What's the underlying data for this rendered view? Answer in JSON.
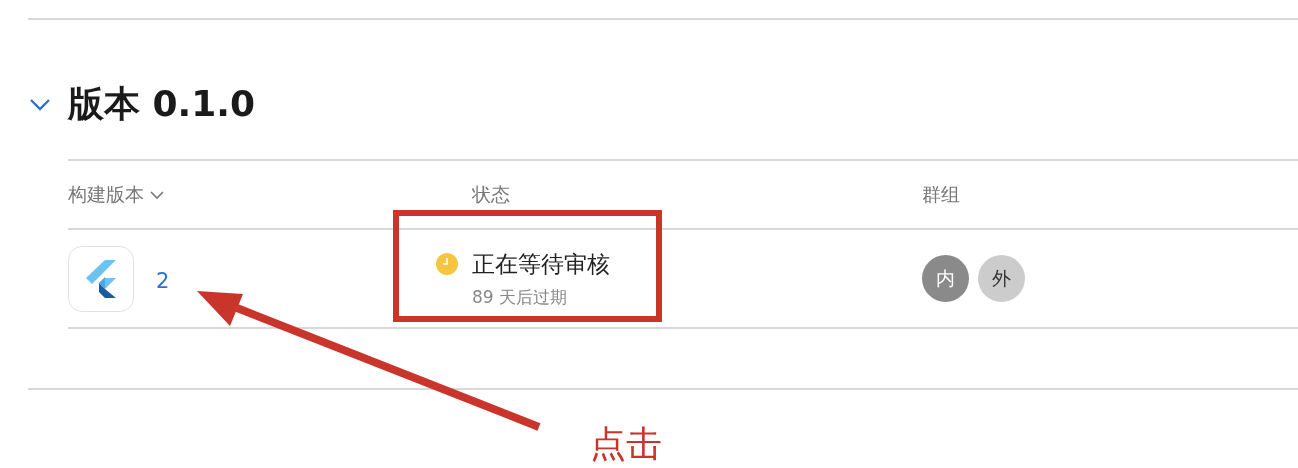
{
  "section": {
    "title": "版本 0.1.0",
    "expanded": true
  },
  "table": {
    "columns": [
      {
        "label": "构建版本",
        "sorted": true
      },
      {
        "label": "状态",
        "sorted": false
      },
      {
        "label": "群组",
        "sorted": false
      }
    ],
    "rows": [
      {
        "build": "2",
        "status": {
          "text": "正在等待审核",
          "detail": "89 天后过期",
          "color": "#f5c542"
        },
        "groups": [
          {
            "label": "内",
            "color": "#8a8a8a"
          },
          {
            "label": "外",
            "color": "#cccccc"
          }
        ]
      }
    ]
  },
  "annotation": {
    "label": "点击"
  }
}
